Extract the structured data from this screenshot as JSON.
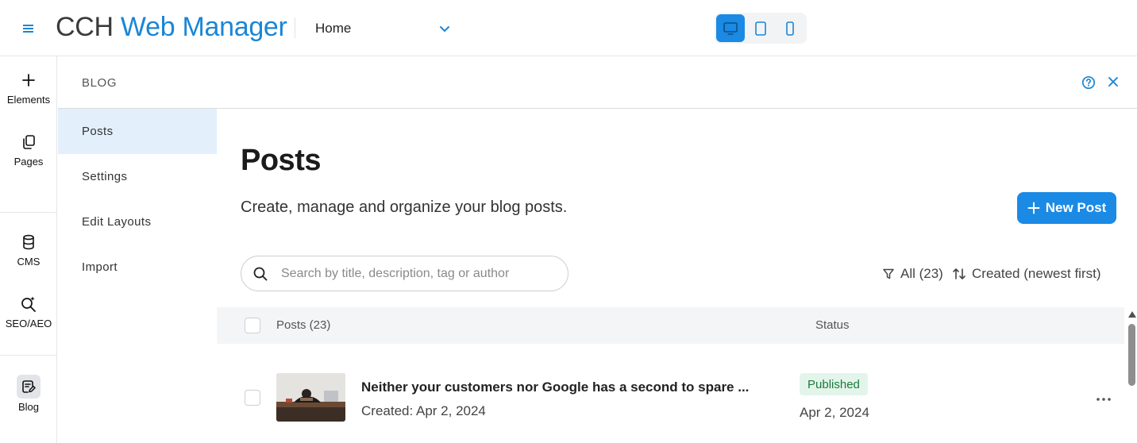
{
  "topbar": {
    "logo_part1": "CCH",
    "logo_part2": "Web Manager",
    "page_select": "Home",
    "devices": [
      {
        "name": "desktop",
        "active": true
      },
      {
        "name": "tablet",
        "active": false
      },
      {
        "name": "mobile",
        "active": false
      }
    ]
  },
  "rail": {
    "items": [
      {
        "label": "Elements",
        "icon": "plus-icon"
      },
      {
        "label": "Pages",
        "icon": "pages-icon"
      },
      {
        "label": "CMS",
        "icon": "database-icon"
      },
      {
        "label": "SEO/AEO",
        "icon": "seo-search-icon"
      },
      {
        "label": "Blog",
        "icon": "blog-icon"
      }
    ]
  },
  "panel": {
    "title": "BLOG"
  },
  "subnav": {
    "items": [
      {
        "label": "Posts",
        "active": true
      },
      {
        "label": "Settings",
        "active": false
      },
      {
        "label": "Edit Layouts",
        "active": false
      },
      {
        "label": "Import",
        "active": false
      }
    ]
  },
  "main": {
    "heading": "Posts",
    "subtitle": "Create, manage and organize your blog posts.",
    "new_post_label": "New Post",
    "search_placeholder": "Search by title, description, tag or author",
    "filter_label": "All (23)",
    "sort_label": "Created (newest first)",
    "table": {
      "col_posts": "Posts (23)",
      "col_status": "Status",
      "rows": [
        {
          "title": "Neither your customers nor Google has a second to spare ...",
          "created": "Created: Apr 2, 2024",
          "status": "Published",
          "status_date": "Apr 2, 2024"
        }
      ]
    }
  },
  "colors": {
    "accent": "#1a8ae5",
    "published_bg": "#e3f5ea",
    "published_text": "#1c7a3e"
  }
}
